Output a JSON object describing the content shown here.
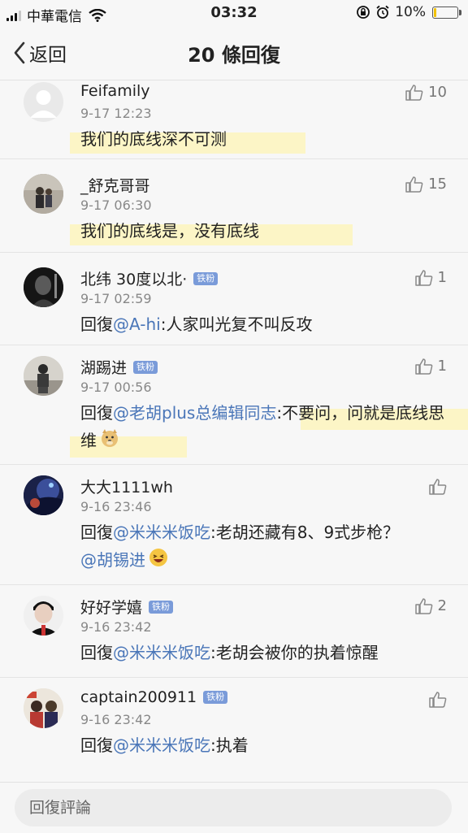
{
  "status_bar": {
    "carrier": "中華電信",
    "time": "03:32",
    "battery_pct": "10%",
    "battery_level": 0.1
  },
  "nav": {
    "back_label": "返回",
    "title": "20 條回復"
  },
  "comments": [
    {
      "name": "Feifamily",
      "badge": "",
      "time": "9-17 12:23",
      "likes": "10",
      "text": "我们的底线深不可测",
      "reply_prefix": "",
      "mention": "",
      "after": "",
      "mention2": ""
    },
    {
      "name": "_舒克哥哥",
      "badge": "",
      "time": "9-17 06:30",
      "likes": "15",
      "text": "我们的底线是，没有底线",
      "reply_prefix": "",
      "mention": "",
      "after": "",
      "mention2": ""
    },
    {
      "name": "北纬 30度以北·",
      "badge": "铁粉",
      "time": "9-17 02:59",
      "likes": "1",
      "reply_prefix": "回復",
      "mention": "@A-hi",
      "after": ":人家叫光复不叫反攻",
      "mention2": ""
    },
    {
      "name": "湖踢进",
      "badge": "铁粉",
      "time": "9-17 00:56",
      "likes": "1",
      "reply_prefix": "回復",
      "mention": "@老胡plus总编辑同志",
      "after": ":不要问，问就是底线思维",
      "mention2": ""
    },
    {
      "name": "大大1111wh",
      "badge": "",
      "time": "9-16 23:46",
      "likes": "",
      "reply_prefix": "回復",
      "mention": "@米米米饭吃",
      "after": ":老胡还藏有8、9式步枪？",
      "mention2": "@胡锡进"
    },
    {
      "name": "好好学嬉",
      "badge": "铁粉",
      "time": "9-16 23:42",
      "likes": "2",
      "reply_prefix": "回復",
      "mention": "@米米米饭吃",
      "after": ":老胡会被你的执着惊醒",
      "mention2": ""
    },
    {
      "name": "captain200911",
      "badge": "铁粉",
      "time": "9-16 23:42",
      "likes": "",
      "reply_prefix": "回復",
      "mention": "@米米米饭吃",
      "after": ":执着",
      "mention2": ""
    }
  ],
  "bottom": {
    "placeholder": "回復評論"
  },
  "icons": {
    "like": "thumbs-up-icon",
    "back": "chevron-left-icon"
  },
  "colors": {
    "mention": "#4a76b8",
    "badge": "#7a9bd9",
    "highlight": "#fcf5c6"
  }
}
